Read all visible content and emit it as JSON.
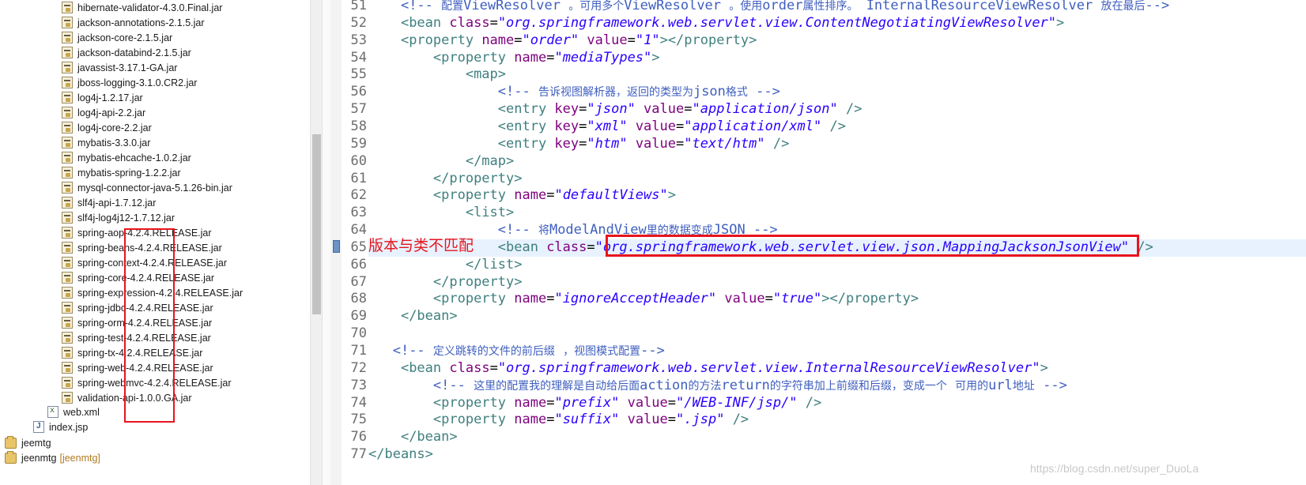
{
  "tree": {
    "jar_files": [
      "hibernate-validator-4.3.0.Final.jar",
      "jackson-annotations-2.1.5.jar",
      "jackson-core-2.1.5.jar",
      "jackson-databind-2.1.5.jar",
      "javassist-3.17.1-GA.jar",
      "jboss-logging-3.1.0.CR2.jar",
      "log4j-1.2.17.jar",
      "log4j-api-2.2.jar",
      "log4j-core-2.2.jar",
      "mybatis-3.3.0.jar",
      "mybatis-ehcache-1.0.2.jar",
      "mybatis-spring-1.2.2.jar",
      "mysql-connector-java-5.1.26-bin.jar",
      "slf4j-api-1.7.12.jar",
      "slf4j-log4j12-1.7.12.jar",
      "spring-aop-4.2.4.RELEASE.jar",
      "spring-beans-4.2.4.RELEASE.jar",
      "spring-context-4.2.4.RELEASE.jar",
      "spring-core-4.2.4.RELEASE.jar",
      "spring-expression-4.2.4.RELEASE.jar",
      "spring-jdbc-4.2.4.RELEASE.jar",
      "spring-orm-4.2.4.RELEASE.jar",
      "spring-test-4.2.4.RELEASE.jar",
      "spring-tx-4.2.4.RELEASE.jar",
      "spring-web-4.2.4.RELEASE.jar",
      "spring-webmvc-4.2.4.RELEASE.jar",
      "validation-api-1.0.0.GA.jar"
    ],
    "web_xml": "web.xml",
    "index_jsp": "index.jsp",
    "project1": "jeemtg",
    "project2": "jeenmtg",
    "project2_tag": "[jeenmtg]"
  },
  "editor": {
    "lines": [
      {
        "n": "51",
        "code": "    <!-- 配置ViewResolver 。可用多个ViewResolver 。使用order属性排序。 InternalResourceViewResolver 放在最后-->"
      },
      {
        "n": "52",
        "code": "    <bean class=\"org.springframework.web.servlet.view.ContentNegotiatingViewResolver\">"
      },
      {
        "n": "53",
        "code": "    <property name=\"order\" value=\"1\"></property>"
      },
      {
        "n": "54",
        "code": "        <property name=\"mediaTypes\">"
      },
      {
        "n": "55",
        "code": "            <map>"
      },
      {
        "n": "56",
        "code": "                <!-- 告诉视图解析器，返回的类型为json格式 -->"
      },
      {
        "n": "57",
        "code": "                <entry key=\"json\" value=\"application/json\" />"
      },
      {
        "n": "58",
        "code": "                <entry key=\"xml\" value=\"application/xml\" />"
      },
      {
        "n": "59",
        "code": "                <entry key=\"htm\" value=\"text/htm\" />"
      },
      {
        "n": "60",
        "code": "            </map>"
      },
      {
        "n": "61",
        "code": "        </property>"
      },
      {
        "n": "62",
        "code": "        <property name=\"defaultViews\">"
      },
      {
        "n": "63",
        "code": "            <list>"
      },
      {
        "n": "64",
        "code": "                <!-- 将ModelAndView里的数据变成JSON -->"
      },
      {
        "n": "65",
        "code": "                <bean class=\"org.springframework.web.servlet.view.json.MappingJacksonJsonView\" />"
      },
      {
        "n": "66",
        "code": "            </list>"
      },
      {
        "n": "67",
        "code": "        </property>"
      },
      {
        "n": "68",
        "code": "        <property name=\"ignoreAcceptHeader\" value=\"true\"></property>"
      },
      {
        "n": "69",
        "code": "    </bean>"
      },
      {
        "n": "70",
        "code": ""
      },
      {
        "n": "71",
        "code": "   <!-- 定义跳转的文件的前后缀 ，视图模式配置-->"
      },
      {
        "n": "72",
        "code": "    <bean class=\"org.springframework.web.servlet.view.InternalResourceViewResolver\">"
      },
      {
        "n": "73",
        "code": "        <!-- 这里的配置我的理解是自动给后面action的方法return的字符串加上前缀和后缀，变成一个 可用的url地址 -->"
      },
      {
        "n": "74",
        "code": "        <property name=\"prefix\" value=\"/WEB-INF/jsp/\" />"
      },
      {
        "n": "75",
        "code": "        <property name=\"suffix\" value=\".jsp\" />"
      },
      {
        "n": "76",
        "code": "    </bean>"
      },
      {
        "n": "77",
        "code": "</beans>"
      }
    ]
  },
  "annotation": {
    "text": "版本与类不匹配",
    "color": "#e8141c"
  },
  "watermark": "https://blog.csdn.net/super_DuoLa"
}
